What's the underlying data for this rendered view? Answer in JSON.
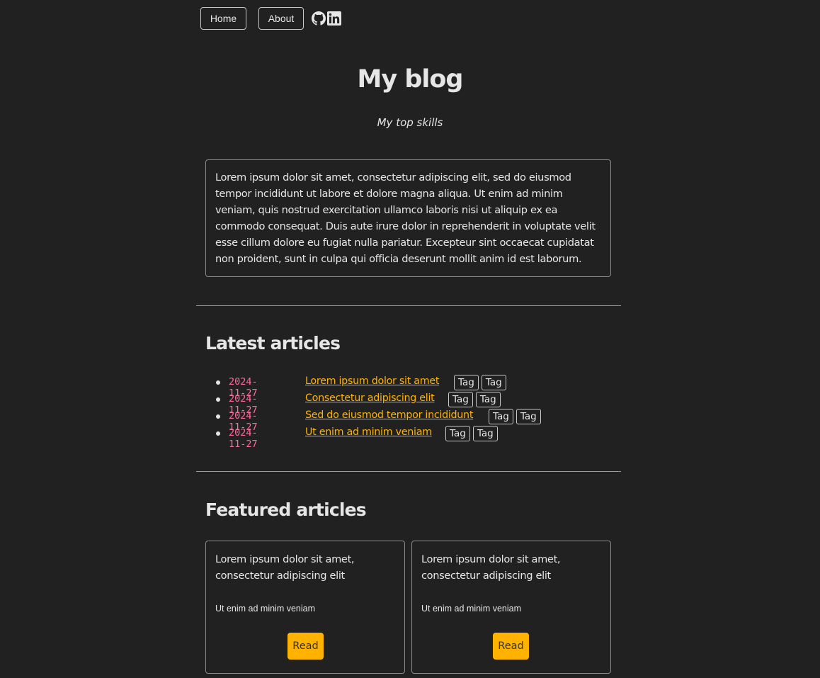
{
  "nav": {
    "home_label": "Home",
    "about_label": "About",
    "icons": [
      "github-icon",
      "linkedin-icon"
    ]
  },
  "header": {
    "title": "My blog",
    "subtitle": "My top skills"
  },
  "intro": {
    "text": "Lorem ipsum dolor sit amet, consectetur adipiscing elit, sed do eiusmod tempor incididunt ut labore et dolore magna aliqua. Ut enim ad minim veniam, quis nostrud exercitation ullamco laboris nisi ut aliquip ex ea commodo consequat. Duis aute irure dolor in reprehenderit in voluptate velit esse cillum dolore eu fugiat nulla pariatur. Excepteur sint occaecat cupidatat non proident, sunt in culpa qui officia deserunt mollit anim id est laborum."
  },
  "latest": {
    "heading": "Latest articles",
    "articles": [
      {
        "date": "2024-11-27",
        "title": "Lorem ipsum dolor sit amet",
        "tags": [
          "Tag",
          "Tag"
        ]
      },
      {
        "date": "2024-11-27",
        "title": "Consectetur adipiscing elit",
        "tags": [
          "Tag",
          "Tag"
        ]
      },
      {
        "date": "2024-11-27",
        "title": "Sed do eiusmod tempor incididunt",
        "tags": [
          "Tag",
          "Tag"
        ]
      },
      {
        "date": "2024-11-27",
        "title": "Ut enim ad minim veniam",
        "tags": [
          "Tag",
          "Tag"
        ]
      }
    ]
  },
  "featured": {
    "heading": "Featured articles",
    "cards": [
      {
        "title": "Lorem ipsum dolor sit amet, consectetur adipiscing elit",
        "description": "Ut enim ad minim veniam",
        "button_label": "Read"
      },
      {
        "title": "Lorem ipsum dolor sit amet, consectetur adipiscing elit",
        "description": "Ut enim ad minim veniam",
        "button_label": "Read"
      }
    ]
  },
  "colors": {
    "background": "#212121",
    "text": "#e6e6e6",
    "accent": "#ffb300",
    "date": "#ff6b9a"
  }
}
